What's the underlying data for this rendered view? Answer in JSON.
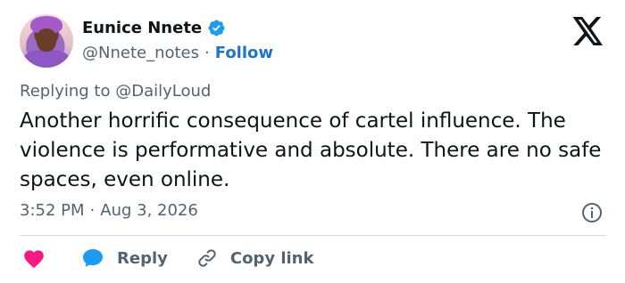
{
  "author": {
    "name": "Eunice Nnete",
    "handle": "@Nnete_notes",
    "separator": "·",
    "follow_label": "Follow"
  },
  "reply_context": {
    "prefix": "Replying to",
    "mention": "@DailyLoud"
  },
  "tweet": {
    "text": "Another horrific consequence of cartel influence. The violence is performative and absolute. There are no safe spaces, even online.",
    "time": "3:52 PM",
    "separator": "·",
    "date": "Aug 3, 2026"
  },
  "actions": {
    "reply_label": "Reply",
    "copy_link_label": "Copy link"
  },
  "icons": {
    "verified": "verified-badge-icon",
    "brand": "x-logo-icon",
    "info": "info-icon",
    "like": "heart-icon",
    "reply": "speech-bubble-icon",
    "copy": "link-icon"
  },
  "colors": {
    "text_primary": "#0f1419",
    "text_secondary": "#536471",
    "accent_blue": "#1d74c9",
    "like_pink": "#f91880",
    "divider": "#cfd9de"
  }
}
